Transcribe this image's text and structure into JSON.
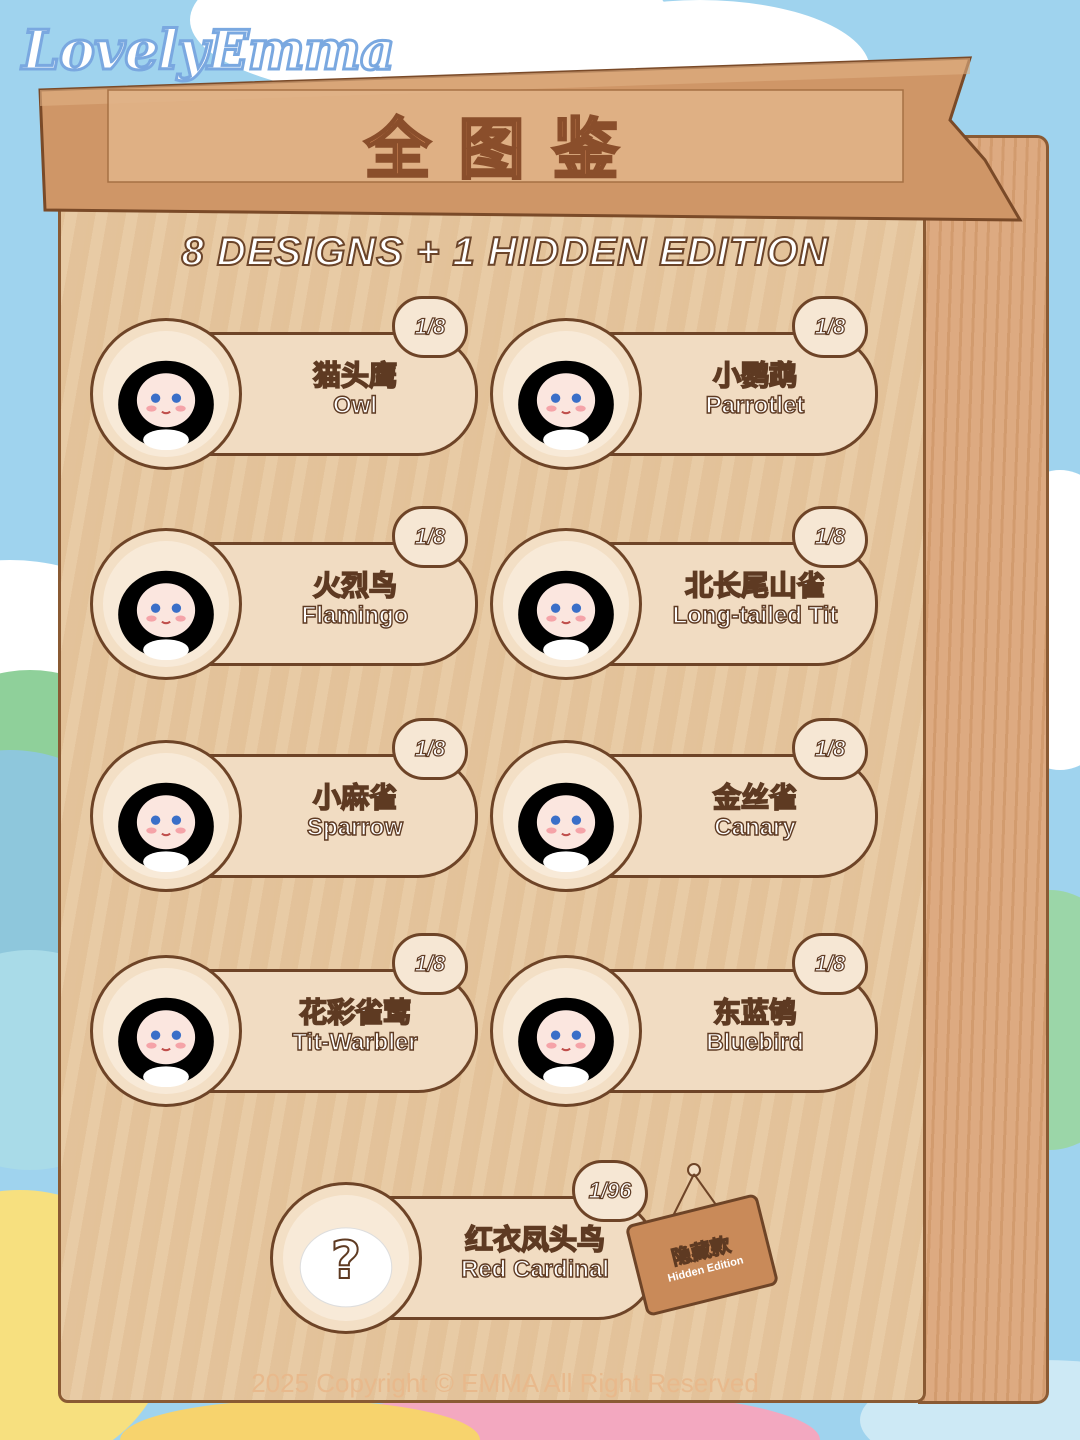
{
  "brand": {
    "logo": "LovelyEmma"
  },
  "banner": {
    "title": "全图鉴"
  },
  "subtitle": "8 DESIGNS + 1 HIDDEN EDITION",
  "colors": {
    "wood": "#e7c8a0",
    "wood_dark": "#8a5a33",
    "sky": "#9fd3ee",
    "banner": "#c98a59"
  },
  "designs": [
    {
      "name_zh": "猫头鹰",
      "name_en": "Owl",
      "ratio": "1/8",
      "color": "#5d86c8"
    },
    {
      "name_zh": "小鹦鹉",
      "name_en": "Parrotlet",
      "ratio": "1/8",
      "color": "#9fd48e"
    },
    {
      "name_zh": "火烈鸟",
      "name_en": "Flamingo",
      "ratio": "1/8",
      "color": "#f29aa3"
    },
    {
      "name_zh": "北长尾山雀",
      "name_en": "Long-tailed Tit",
      "ratio": "1/8",
      "color": "#8a8d96"
    },
    {
      "name_zh": "小麻雀",
      "name_en": "Sparrow",
      "ratio": "1/8",
      "color": "#8b5a36"
    },
    {
      "name_zh": "金丝雀",
      "name_en": "Canary",
      "ratio": "1/8",
      "color": "#f5d66b"
    },
    {
      "name_zh": "花彩雀莺",
      "name_en": "Tit-Warbler",
      "ratio": "1/8",
      "color": "#f08a3c"
    },
    {
      "name_zh": "东蓝鸲",
      "name_en": "Bluebird",
      "ratio": "1/8",
      "color": "#7fa6d8"
    }
  ],
  "hidden": {
    "name_zh": "红衣凤头鸟",
    "name_en": "Red Cardinal",
    "ratio": "1/96",
    "mystery": "?",
    "tag_zh": "隐藏款",
    "tag_en": "Hidden Edition"
  },
  "footer": "2025 Copyright © EMMA All Right Reserved"
}
